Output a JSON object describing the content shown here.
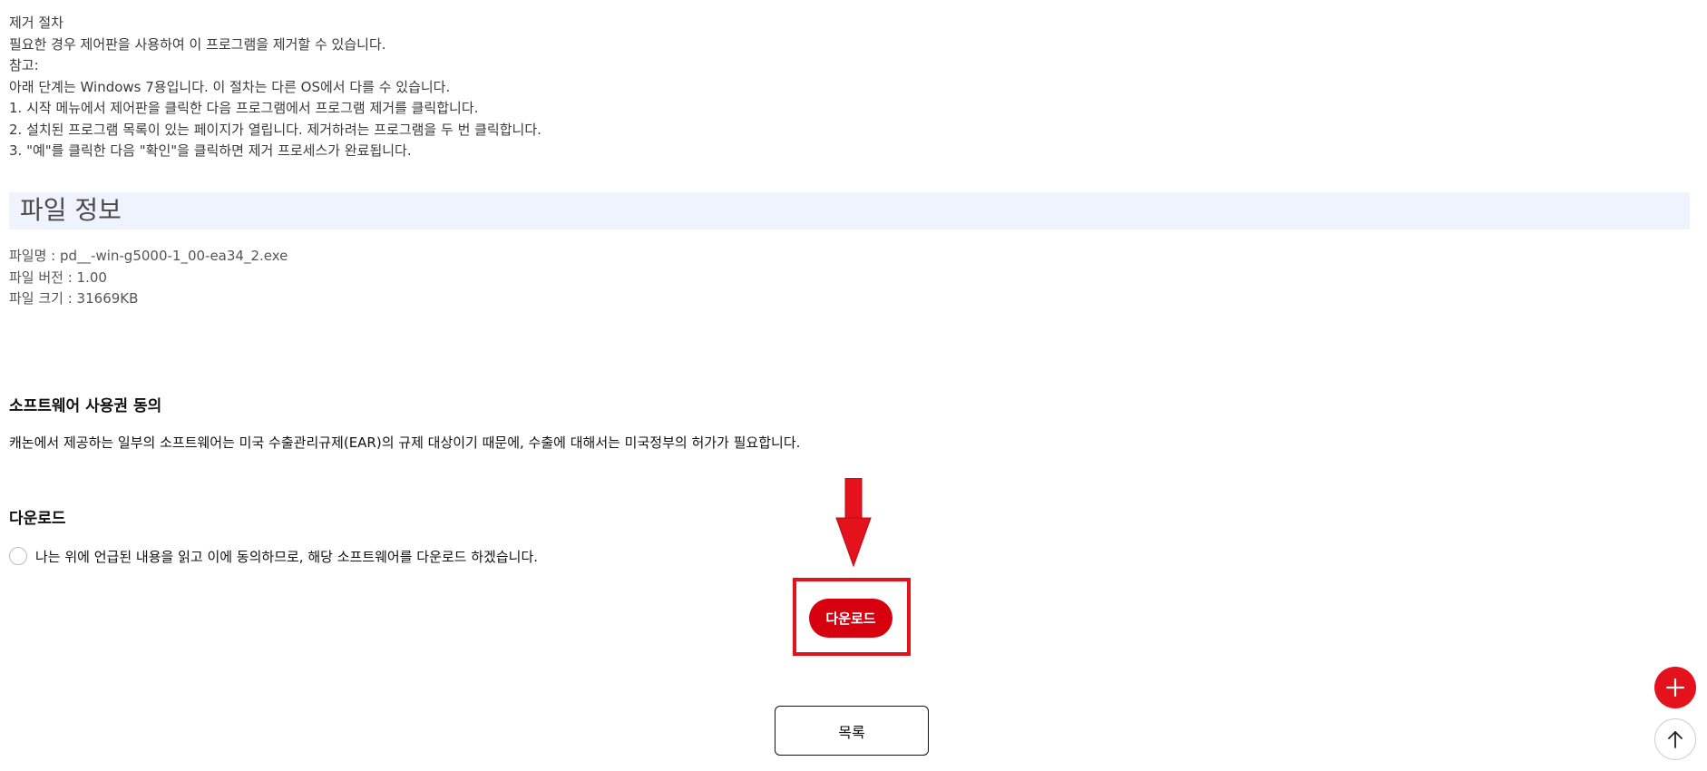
{
  "removal": {
    "lines": [
      "제거 절차",
      "필요한 경우 제어판을 사용하여 이 프로그램을 제거할 수 있습니다.",
      "참고:",
      "아래 단계는 Windows 7용입니다. 이 절차는 다른 OS에서 다를 수 있습니다.",
      "1. 시작 메뉴에서 제어판을 클릭한 다음 프로그램에서 프로그램 제거를 클릭합니다.",
      "2. 설치된 프로그램 목록이 있는 페이지가 열립니다. 제거하려는 프로그램을 두 번 클릭합니다.",
      "3. \"예\"를 클릭한 다음 \"확인\"을 클릭하면 제거 프로세스가 완료됩니다."
    ]
  },
  "file_info": {
    "title": "파일 정보",
    "name": "파일명 : pd__-win-g5000-1_00-ea34_2.exe",
    "version": "파일 버전 : 1.00",
    "size": "파일 크기 : 31669KB"
  },
  "license": {
    "heading": "소프트웨어 사용권 동의",
    "text": "캐논에서 제공하는 일부의 소프트웨어는 미국 수출관리규제(EAR)의 규제 대상이기 때문에, 수출에 대해서는 미국정부의 허가가 필요합니다."
  },
  "download": {
    "heading": "다운로드",
    "agree_label": "나는 위에 언급된 내용을 읽고 이에 동의하므로, 해당 소프트웨어를 다운로드 하겠습니다.",
    "button_label": "다운로드"
  },
  "list_button_label": "목록",
  "colors": {
    "accent": "#d7000f",
    "highlight": "#e3121c",
    "section_bg": "#eef3fd"
  },
  "icons": {
    "fab_plus": "plus-icon",
    "fab_top": "arrow-up-icon",
    "annotation": "arrow-down-icon"
  }
}
